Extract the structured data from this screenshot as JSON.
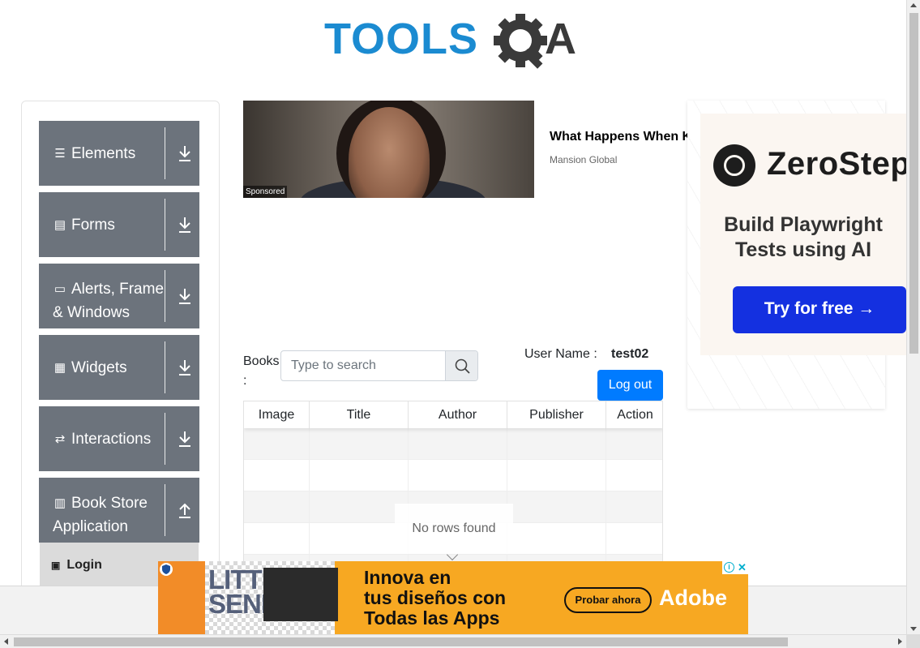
{
  "header": {
    "logo_text_tools": "TOOLS",
    "logo_text_qa": "QA",
    "brand_color": "#1b8bd1",
    "gear_color": "#3a3a3a"
  },
  "sidebar": {
    "groups": [
      {
        "label": "Elements",
        "icon": "list-icon",
        "toggle": "download-arrow-icon"
      },
      {
        "label": "Forms",
        "icon": "form-icon",
        "toggle": "download-arrow-icon"
      },
      {
        "label": "Alerts, Frame & Windows",
        "icon": "window-icon",
        "toggle": "download-arrow-icon"
      },
      {
        "label": "Widgets",
        "icon": "widgets-icon",
        "toggle": "download-arrow-icon"
      },
      {
        "label": "Interactions",
        "icon": "interactions-icon",
        "toggle": "download-arrow-icon"
      },
      {
        "label": "Book Store Application",
        "icon": "books-icon",
        "toggle": "upload-arrow-icon"
      }
    ],
    "active_item": {
      "label": "Login",
      "icon": "login-icon"
    },
    "group_color": "#6c737c"
  },
  "sponsored": {
    "tag": "Sponsored",
    "title": "What Happens When K",
    "source": "Mansion Global"
  },
  "zerostep_ad": {
    "brand": "ZeroStep",
    "tagline_line1": "Build Playwright",
    "tagline_line2": "Tests using AI",
    "cta": "Try for free →",
    "cta_color": "#1430e0"
  },
  "books": {
    "label": "Books :",
    "search_placeholder": "Type to search",
    "user_name_label": "User Name :",
    "user_name_value": "test02",
    "logout_label": "Log out",
    "logout_color": "#007bff",
    "table": {
      "columns": [
        "Image",
        "Title",
        "Author",
        "Publisher",
        "Action"
      ],
      "empty_message": "No rows found"
    }
  },
  "bottom_ad": {
    "preview_brand_line1": "LITTLE",
    "preview_brand_line2": "SENEGAL",
    "headline_line1": "Innova en",
    "headline_line2": "tus diseños con",
    "headline_line3": "Todas las Apps",
    "cta": "Probar ahora",
    "brand": "Adobe",
    "background_color": "#f7a822"
  }
}
